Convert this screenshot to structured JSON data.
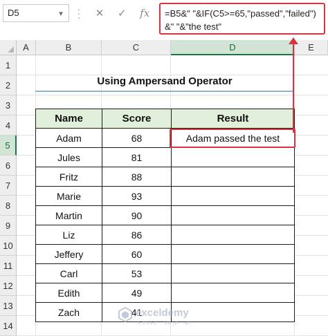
{
  "formula_bar": {
    "name_box": "D5",
    "icons": [
      "more-options-icon",
      "cancel-icon",
      "confirm-icon",
      "insert-function-icon"
    ],
    "fx_label": "fx",
    "formula": "=B5&\" \"&IF(C5>=65,\"passed\",\"failed\")\n&\" \"&\"the test\""
  },
  "grid": {
    "columns": [
      "A",
      "B",
      "C",
      "D",
      "E"
    ],
    "selected_column": "D",
    "rows": [
      "1",
      "2",
      "3",
      "4",
      "5",
      "6",
      "7",
      "8",
      "9",
      "10",
      "11",
      "12",
      "13",
      "14"
    ],
    "selected_row": "5"
  },
  "sheet": {
    "title": "Using Ampersand Operator",
    "headers": {
      "name": "Name",
      "score": "Score",
      "result": "Result"
    },
    "records": [
      {
        "name": "Adam",
        "score": "68",
        "result": "Adam passed the test"
      },
      {
        "name": "Jules",
        "score": "81",
        "result": ""
      },
      {
        "name": "Fritz",
        "score": "88",
        "result": ""
      },
      {
        "name": "Marie",
        "score": "93",
        "result": ""
      },
      {
        "name": "Martin",
        "score": "90",
        "result": ""
      },
      {
        "name": "Liz",
        "score": "86",
        "result": ""
      },
      {
        "name": "Jeffery",
        "score": "60",
        "result": ""
      },
      {
        "name": "Carl",
        "score": "53",
        "result": ""
      },
      {
        "name": "Edith",
        "score": "49",
        "result": ""
      },
      {
        "name": "Zach",
        "score": "41",
        "result": ""
      }
    ]
  },
  "watermark": {
    "brand": "exceldemy",
    "tagline": "EXCEL · DATA · BI"
  },
  "colors": {
    "highlight": "#d9333f",
    "header_fill": "#e2efda",
    "excel_green": "#217346"
  }
}
